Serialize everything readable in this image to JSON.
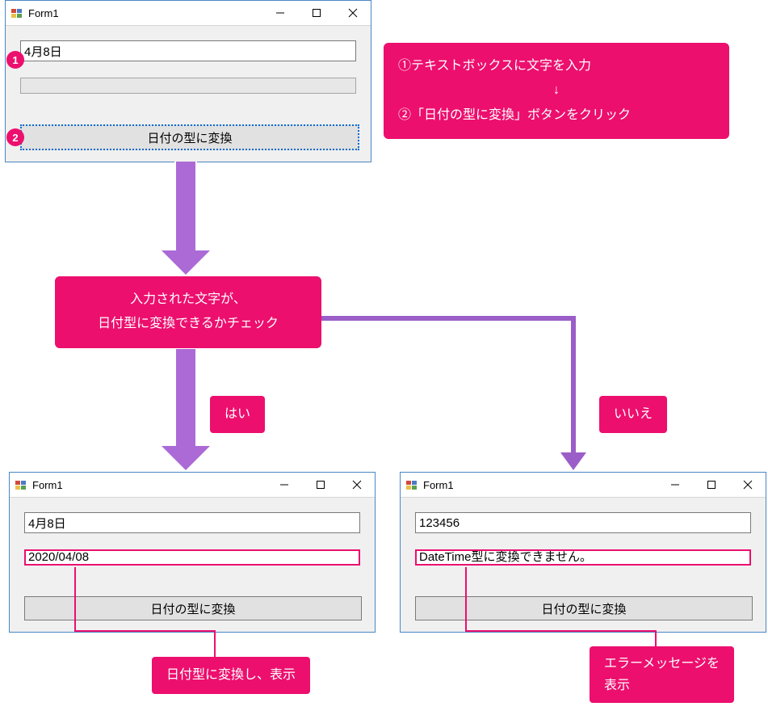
{
  "topForm": {
    "title": "Form1",
    "input": "4月8日",
    "output": "",
    "button": "日付の型に変換"
  },
  "yesForm": {
    "title": "Form1",
    "input": "4月8日",
    "output": "2020/04/08",
    "button": "日付の型に変換"
  },
  "noForm": {
    "title": "Form1",
    "input": "123456",
    "output": "DateTime型に変換できません。",
    "button": "日付の型に変換"
  },
  "badges": {
    "one": "1",
    "two": "2"
  },
  "instructions": {
    "line1": "①テキストボックスに文字を入力",
    "arrow": "↓",
    "line2": "②「日付の型に変換」ボタンをクリック"
  },
  "decision": {
    "line1": "入力された文字が、",
    "line2": "日付型に変換できるかチェック"
  },
  "branch": {
    "yes": "はい",
    "no": "いいえ"
  },
  "results": {
    "yes": "日付型に変換し、表示",
    "noLine1": "エラーメッセージを",
    "noLine2": "表示"
  }
}
